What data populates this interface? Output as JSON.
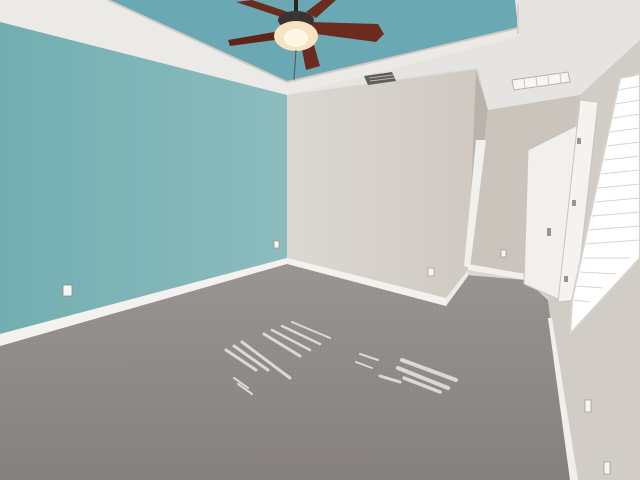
{
  "scene": {
    "subject": "empty-bedroom-interior",
    "colors": {
      "accent_wall": "#7fb3b6",
      "tray_ceiling": "#6aa9b3",
      "neutral_wall": "#d8d3cc",
      "ceiling": "#e8e6e2",
      "carpet": "#8f8a87",
      "trim": "#f4f2ee",
      "fan_blade": "#6b2b1f",
      "door": "#f1f0ec"
    },
    "icons": [
      "ceiling-fan-icon",
      "air-vent-icon",
      "electrical-outlet-icon",
      "door-icon",
      "window-blinds-icon"
    ]
  }
}
